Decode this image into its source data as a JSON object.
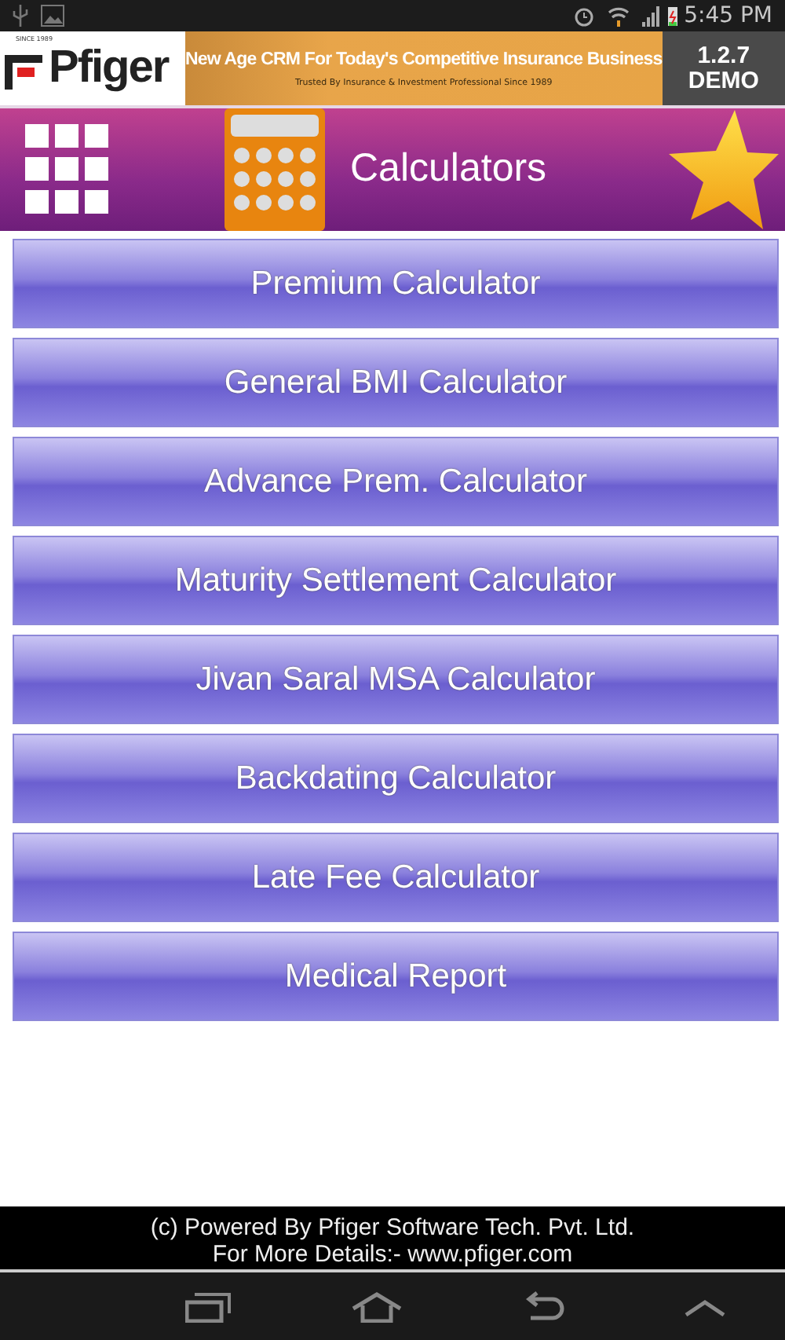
{
  "status_bar": {
    "time": "5:45 PM"
  },
  "header": {
    "logo_tagline": "SINCE 1989",
    "logo_text": "Pfiger",
    "banner_title": "New Age CRM For Today's Competitive Insurance Business",
    "banner_subtitle": "Trusted By Insurance & Investment Professional Since 1989",
    "version": "1.2.7",
    "edition": "DEMO"
  },
  "title_bar": {
    "title": "Calculators"
  },
  "menu": [
    {
      "label": "Premium Calculator"
    },
    {
      "label": "General BMI Calculator"
    },
    {
      "label": "Advance Prem. Calculator"
    },
    {
      "label": "Maturity Settlement Calculator"
    },
    {
      "label": "Jivan Saral MSA Calculator"
    },
    {
      "label": "Backdating Calculator"
    },
    {
      "label": "Late Fee Calculator"
    },
    {
      "label": "Medical Report"
    }
  ],
  "footer": {
    "line_1": "(c) Powered By Pfiger Software Tech. Pvt. Ltd.",
    "line_2": "For More Details:- www.pfiger.com"
  }
}
